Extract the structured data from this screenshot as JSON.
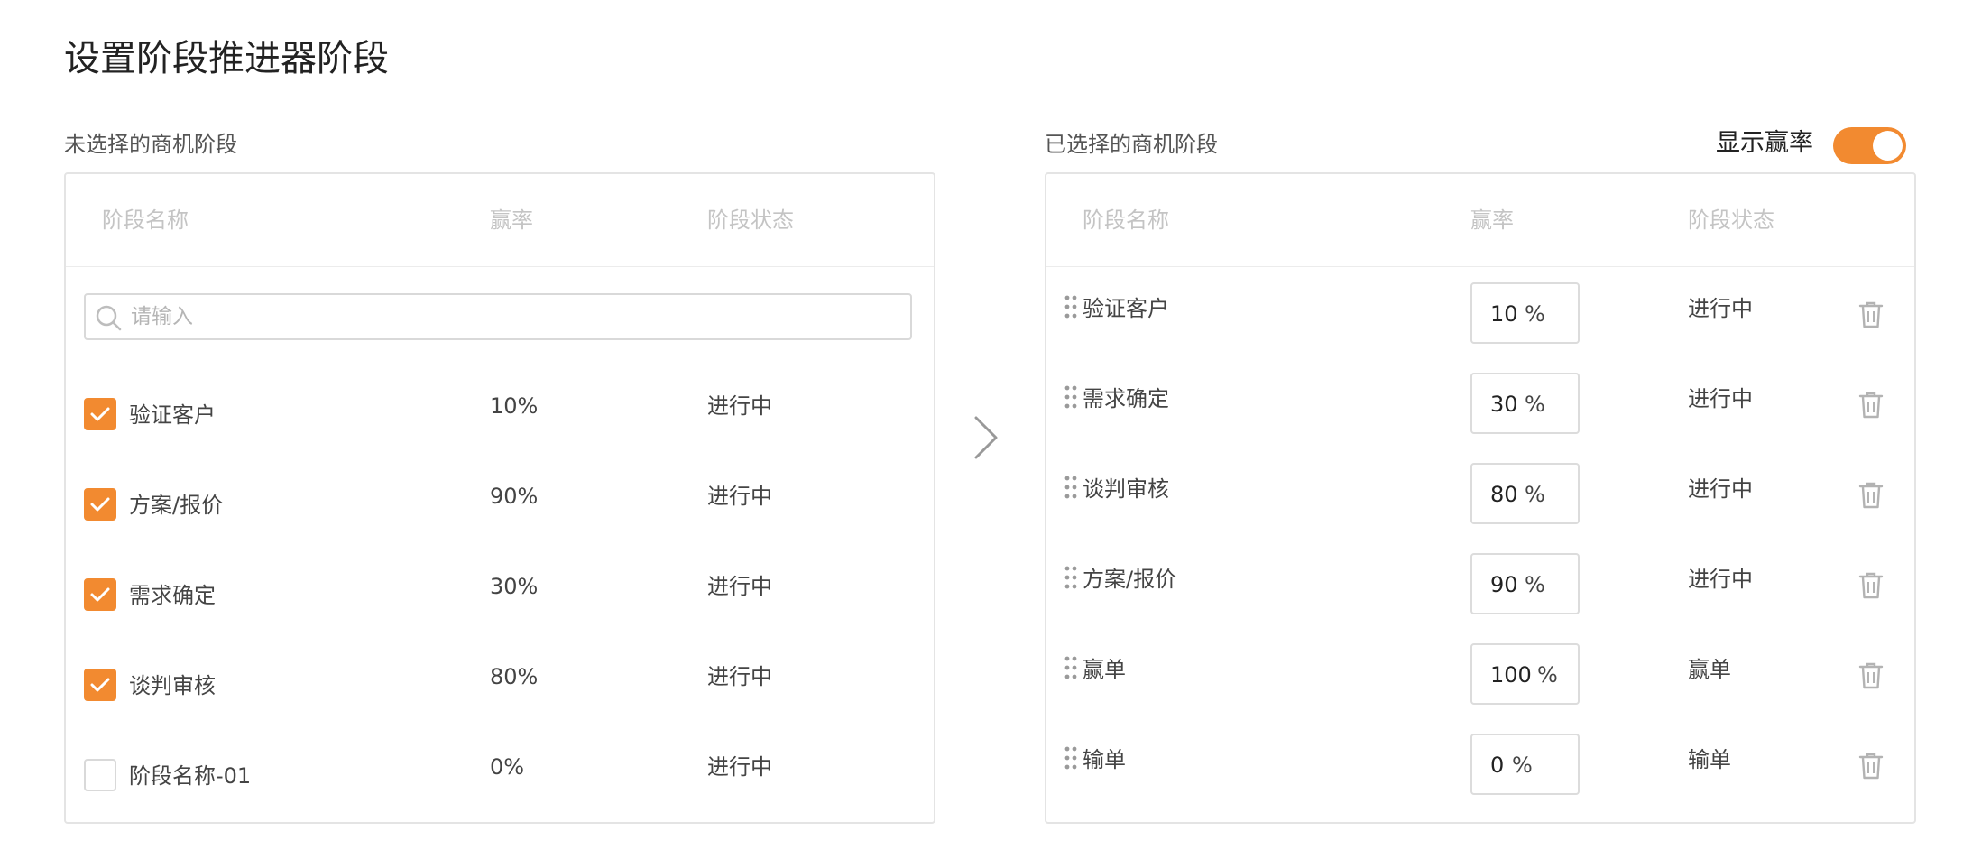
{
  "page": {
    "title": "设置阶段推进器阶段"
  },
  "colors": {
    "accent": "#f28a30",
    "border": "#e4e4e4",
    "header_text": "#c4c4c4"
  },
  "left_panel": {
    "label": "未选择的商机阶段",
    "columns": [
      "阶段名称",
      "赢率",
      "阶段状态"
    ],
    "search": {
      "placeholder": "请输入",
      "value": ""
    },
    "rows": [
      {
        "checked": true,
        "name": "验证客户",
        "rate": "10%",
        "status": "进行中"
      },
      {
        "checked": true,
        "name": "方案/报价",
        "rate": "90%",
        "status": "进行中"
      },
      {
        "checked": true,
        "name": "需求确定",
        "rate": "30%",
        "status": "进行中"
      },
      {
        "checked": true,
        "name": "谈判审核",
        "rate": "80%",
        "status": "进行中"
      },
      {
        "checked": false,
        "name": "阶段名称-01",
        "rate": "0%",
        "status": "进行中"
      }
    ]
  },
  "transfer": {
    "icon": "chevron-right-icon"
  },
  "right_panel": {
    "label": "已选择的商机阶段",
    "toggle": {
      "label": "显示赢率",
      "on": true
    },
    "columns": [
      "阶段名称",
      "赢率",
      "阶段状态"
    ],
    "rate_unit": "%",
    "rows": [
      {
        "name": "验证客户",
        "rate": "10",
        "status": "进行中"
      },
      {
        "name": "需求确定",
        "rate": "30",
        "status": "进行中"
      },
      {
        "name": "谈判审核",
        "rate": "80",
        "status": "进行中"
      },
      {
        "name": "方案/报价",
        "rate": "90",
        "status": "进行中"
      },
      {
        "name": "赢单",
        "rate": "100",
        "status": "赢单"
      },
      {
        "name": "输单",
        "rate": "0",
        "status": "输单"
      }
    ]
  }
}
